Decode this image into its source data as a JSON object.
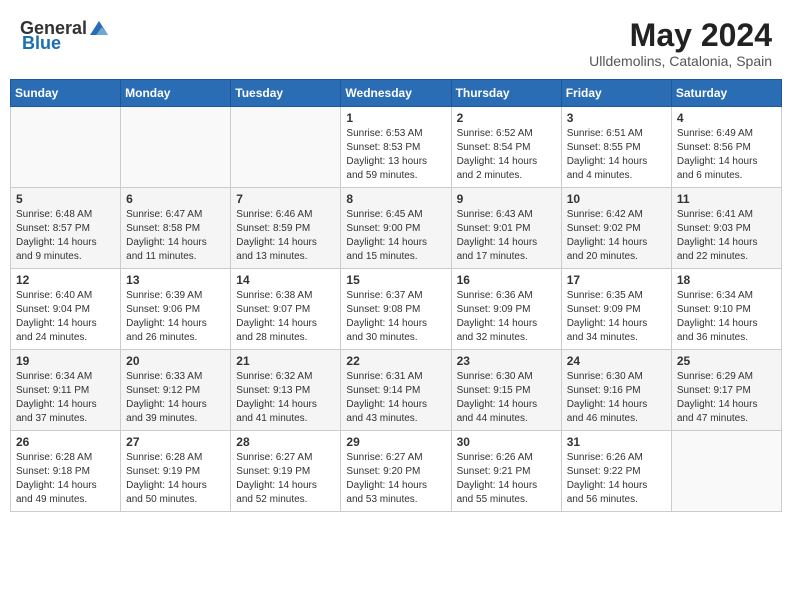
{
  "header": {
    "logo_general": "General",
    "logo_blue": "Blue",
    "title": "May 2024",
    "location": "Ulldemolins, Catalonia, Spain"
  },
  "calendar": {
    "days_of_week": [
      "Sunday",
      "Monday",
      "Tuesday",
      "Wednesday",
      "Thursday",
      "Friday",
      "Saturday"
    ],
    "weeks": [
      {
        "row_class": "row-1",
        "days": [
          {
            "num": "",
            "sunrise": "",
            "sunset": "",
            "daylight": ""
          },
          {
            "num": "",
            "sunrise": "",
            "sunset": "",
            "daylight": ""
          },
          {
            "num": "",
            "sunrise": "",
            "sunset": "",
            "daylight": ""
          },
          {
            "num": "1",
            "sunrise": "Sunrise: 6:53 AM",
            "sunset": "Sunset: 8:53 PM",
            "daylight": "Daylight: 13 hours and 59 minutes."
          },
          {
            "num": "2",
            "sunrise": "Sunrise: 6:52 AM",
            "sunset": "Sunset: 8:54 PM",
            "daylight": "Daylight: 14 hours and 2 minutes."
          },
          {
            "num": "3",
            "sunrise": "Sunrise: 6:51 AM",
            "sunset": "Sunset: 8:55 PM",
            "daylight": "Daylight: 14 hours and 4 minutes."
          },
          {
            "num": "4",
            "sunrise": "Sunrise: 6:49 AM",
            "sunset": "Sunset: 8:56 PM",
            "daylight": "Daylight: 14 hours and 6 minutes."
          }
        ]
      },
      {
        "row_class": "row-2",
        "days": [
          {
            "num": "5",
            "sunrise": "Sunrise: 6:48 AM",
            "sunset": "Sunset: 8:57 PM",
            "daylight": "Daylight: 14 hours and 9 minutes."
          },
          {
            "num": "6",
            "sunrise": "Sunrise: 6:47 AM",
            "sunset": "Sunset: 8:58 PM",
            "daylight": "Daylight: 14 hours and 11 minutes."
          },
          {
            "num": "7",
            "sunrise": "Sunrise: 6:46 AM",
            "sunset": "Sunset: 8:59 PM",
            "daylight": "Daylight: 14 hours and 13 minutes."
          },
          {
            "num": "8",
            "sunrise": "Sunrise: 6:45 AM",
            "sunset": "Sunset: 9:00 PM",
            "daylight": "Daylight: 14 hours and 15 minutes."
          },
          {
            "num": "9",
            "sunrise": "Sunrise: 6:43 AM",
            "sunset": "Sunset: 9:01 PM",
            "daylight": "Daylight: 14 hours and 17 minutes."
          },
          {
            "num": "10",
            "sunrise": "Sunrise: 6:42 AM",
            "sunset": "Sunset: 9:02 PM",
            "daylight": "Daylight: 14 hours and 20 minutes."
          },
          {
            "num": "11",
            "sunrise": "Sunrise: 6:41 AM",
            "sunset": "Sunset: 9:03 PM",
            "daylight": "Daylight: 14 hours and 22 minutes."
          }
        ]
      },
      {
        "row_class": "row-3",
        "days": [
          {
            "num": "12",
            "sunrise": "Sunrise: 6:40 AM",
            "sunset": "Sunset: 9:04 PM",
            "daylight": "Daylight: 14 hours and 24 minutes."
          },
          {
            "num": "13",
            "sunrise": "Sunrise: 6:39 AM",
            "sunset": "Sunset: 9:06 PM",
            "daylight": "Daylight: 14 hours and 26 minutes."
          },
          {
            "num": "14",
            "sunrise": "Sunrise: 6:38 AM",
            "sunset": "Sunset: 9:07 PM",
            "daylight": "Daylight: 14 hours and 28 minutes."
          },
          {
            "num": "15",
            "sunrise": "Sunrise: 6:37 AM",
            "sunset": "Sunset: 9:08 PM",
            "daylight": "Daylight: 14 hours and 30 minutes."
          },
          {
            "num": "16",
            "sunrise": "Sunrise: 6:36 AM",
            "sunset": "Sunset: 9:09 PM",
            "daylight": "Daylight: 14 hours and 32 minutes."
          },
          {
            "num": "17",
            "sunrise": "Sunrise: 6:35 AM",
            "sunset": "Sunset: 9:09 PM",
            "daylight": "Daylight: 14 hours and 34 minutes."
          },
          {
            "num": "18",
            "sunrise": "Sunrise: 6:34 AM",
            "sunset": "Sunset: 9:10 PM",
            "daylight": "Daylight: 14 hours and 36 minutes."
          }
        ]
      },
      {
        "row_class": "row-4",
        "days": [
          {
            "num": "19",
            "sunrise": "Sunrise: 6:34 AM",
            "sunset": "Sunset: 9:11 PM",
            "daylight": "Daylight: 14 hours and 37 minutes."
          },
          {
            "num": "20",
            "sunrise": "Sunrise: 6:33 AM",
            "sunset": "Sunset: 9:12 PM",
            "daylight": "Daylight: 14 hours and 39 minutes."
          },
          {
            "num": "21",
            "sunrise": "Sunrise: 6:32 AM",
            "sunset": "Sunset: 9:13 PM",
            "daylight": "Daylight: 14 hours and 41 minutes."
          },
          {
            "num": "22",
            "sunrise": "Sunrise: 6:31 AM",
            "sunset": "Sunset: 9:14 PM",
            "daylight": "Daylight: 14 hours and 43 minutes."
          },
          {
            "num": "23",
            "sunrise": "Sunrise: 6:30 AM",
            "sunset": "Sunset: 9:15 PM",
            "daylight": "Daylight: 14 hours and 44 minutes."
          },
          {
            "num": "24",
            "sunrise": "Sunrise: 6:30 AM",
            "sunset": "Sunset: 9:16 PM",
            "daylight": "Daylight: 14 hours and 46 minutes."
          },
          {
            "num": "25",
            "sunrise": "Sunrise: 6:29 AM",
            "sunset": "Sunset: 9:17 PM",
            "daylight": "Daylight: 14 hours and 47 minutes."
          }
        ]
      },
      {
        "row_class": "row-5",
        "days": [
          {
            "num": "26",
            "sunrise": "Sunrise: 6:28 AM",
            "sunset": "Sunset: 9:18 PM",
            "daylight": "Daylight: 14 hours and 49 minutes."
          },
          {
            "num": "27",
            "sunrise": "Sunrise: 6:28 AM",
            "sunset": "Sunset: 9:19 PM",
            "daylight": "Daylight: 14 hours and 50 minutes."
          },
          {
            "num": "28",
            "sunrise": "Sunrise: 6:27 AM",
            "sunset": "Sunset: 9:19 PM",
            "daylight": "Daylight: 14 hours and 52 minutes."
          },
          {
            "num": "29",
            "sunrise": "Sunrise: 6:27 AM",
            "sunset": "Sunset: 9:20 PM",
            "daylight": "Daylight: 14 hours and 53 minutes."
          },
          {
            "num": "30",
            "sunrise": "Sunrise: 6:26 AM",
            "sunset": "Sunset: 9:21 PM",
            "daylight": "Daylight: 14 hours and 55 minutes."
          },
          {
            "num": "31",
            "sunrise": "Sunrise: 6:26 AM",
            "sunset": "Sunset: 9:22 PM",
            "daylight": "Daylight: 14 hours and 56 minutes."
          },
          {
            "num": "",
            "sunrise": "",
            "sunset": "",
            "daylight": ""
          }
        ]
      }
    ]
  }
}
